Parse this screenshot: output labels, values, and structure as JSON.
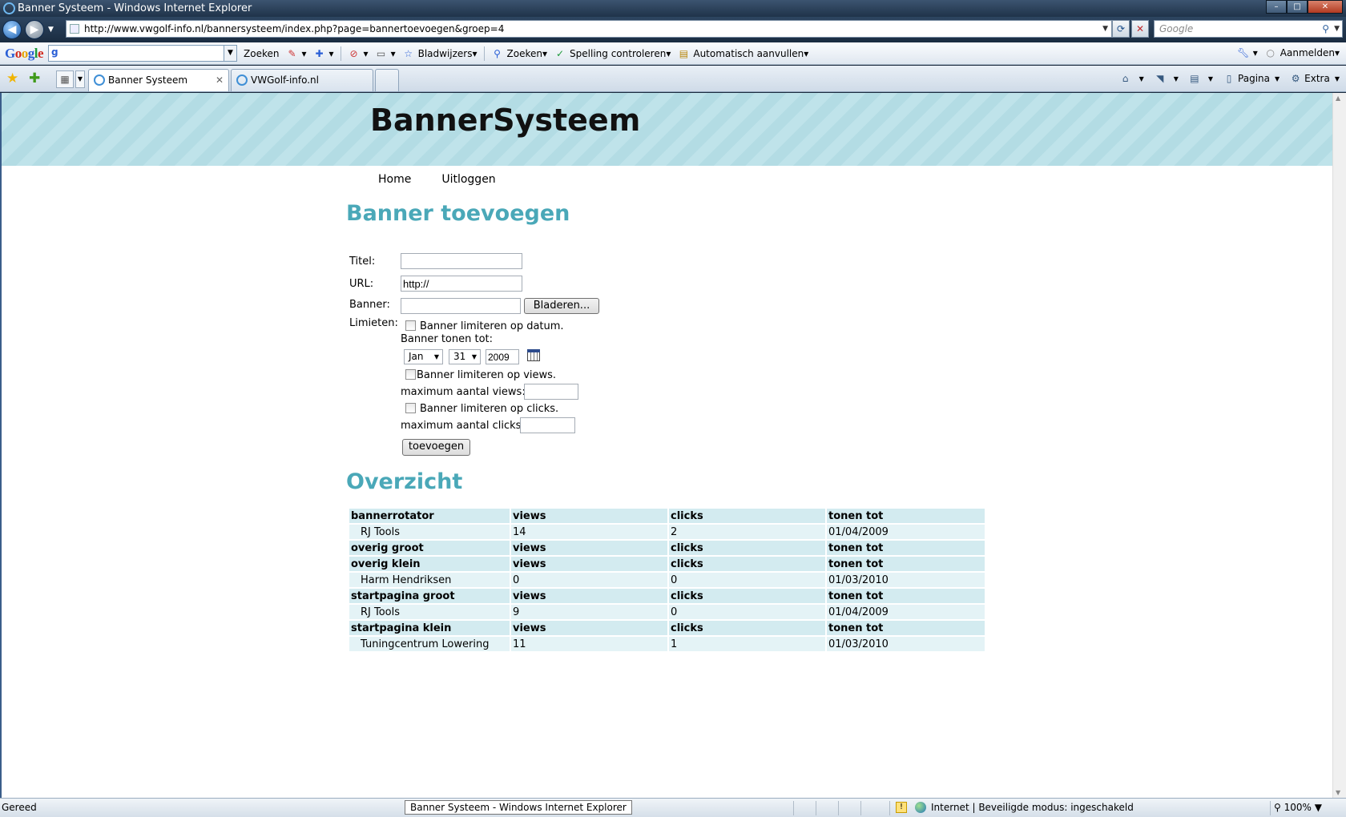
{
  "window": {
    "title": "Banner Systeem - Windows Internet Explorer",
    "minimize_label": "–",
    "maximize_label": "□",
    "close_label": "✕"
  },
  "addressbar": {
    "url": "http://www.vwgolf-info.nl/bannersysteem/index.php?page=bannertoevoegen&groep=4",
    "search_placeholder": "Google"
  },
  "google_toolbar": {
    "search_button": "Zoeken",
    "bookmarks": "Bladwijzers",
    "search2": "Zoeken",
    "spellcheck": "Spelling controleren",
    "autofill": "Automatisch aanvullen",
    "signin": "Aanmelden"
  },
  "tabs": [
    {
      "label": "Banner Systeem"
    },
    {
      "label": "VWGolf-info.nl"
    }
  ],
  "commandbar": {
    "page": "Pagina",
    "tools": "Extra"
  },
  "site": {
    "brand": "BannerSysteem",
    "nav": [
      {
        "label": "Home"
      },
      {
        "label": "Uitloggen"
      }
    ]
  },
  "form": {
    "heading": "Banner toevoegen",
    "title_label": "Titel:",
    "title_value": "",
    "url_label": "URL:",
    "url_value": "http://",
    "banner_label": "Banner:",
    "browse_button": "Bladeren...",
    "limits_label": "Limieten:",
    "limit_date_label": "Banner limiteren op datum.",
    "show_until_label": "Banner tonen tot:",
    "month": "Jan",
    "day": "31",
    "year": "2009",
    "limit_views_label": "Banner limiteren op views.",
    "max_views_label": "maximum aantal views:",
    "limit_clicks_label": "Banner limiteren op clicks.",
    "max_clicks_label": "maximum aantal clicks:",
    "submit_button": "toevoegen"
  },
  "overview": {
    "heading": "Overzicht",
    "rows": [
      {
        "type": "group",
        "c1": "bannerrotator",
        "c2": "views",
        "c3": "clicks",
        "c4": "tonen tot"
      },
      {
        "type": "item",
        "c1": "RJ Tools",
        "c2": "14",
        "c3": "2",
        "c4": "01/04/2009"
      },
      {
        "type": "group",
        "c1": "overig groot",
        "c2": "views",
        "c3": "clicks",
        "c4": "tonen tot"
      },
      {
        "type": "group",
        "c1": "overig klein",
        "c2": "views",
        "c3": "clicks",
        "c4": "tonen tot"
      },
      {
        "type": "item",
        "c1": "Harm Hendriksen",
        "c2": "0",
        "c3": "0",
        "c4": "01/03/2010"
      },
      {
        "type": "group",
        "c1": "startpagina groot",
        "c2": "views",
        "c3": "clicks",
        "c4": "tonen tot"
      },
      {
        "type": "item",
        "c1": "RJ Tools",
        "c2": "9",
        "c3": "0",
        "c4": "01/04/2009"
      },
      {
        "type": "group",
        "c1": "startpagina klein",
        "c2": "views",
        "c3": "clicks",
        "c4": "tonen tot"
      },
      {
        "type": "item",
        "c1": "Tuningcentrum Lowering",
        "c2": "11",
        "c3": "1",
        "c4": "01/03/2010"
      }
    ]
  },
  "statusbar": {
    "state": "Gereed",
    "tooltip": "Banner Systeem - Windows Internet Explorer",
    "zone": "Internet | Beveiligde modus: ingeschakeld",
    "zoom": "100%"
  }
}
